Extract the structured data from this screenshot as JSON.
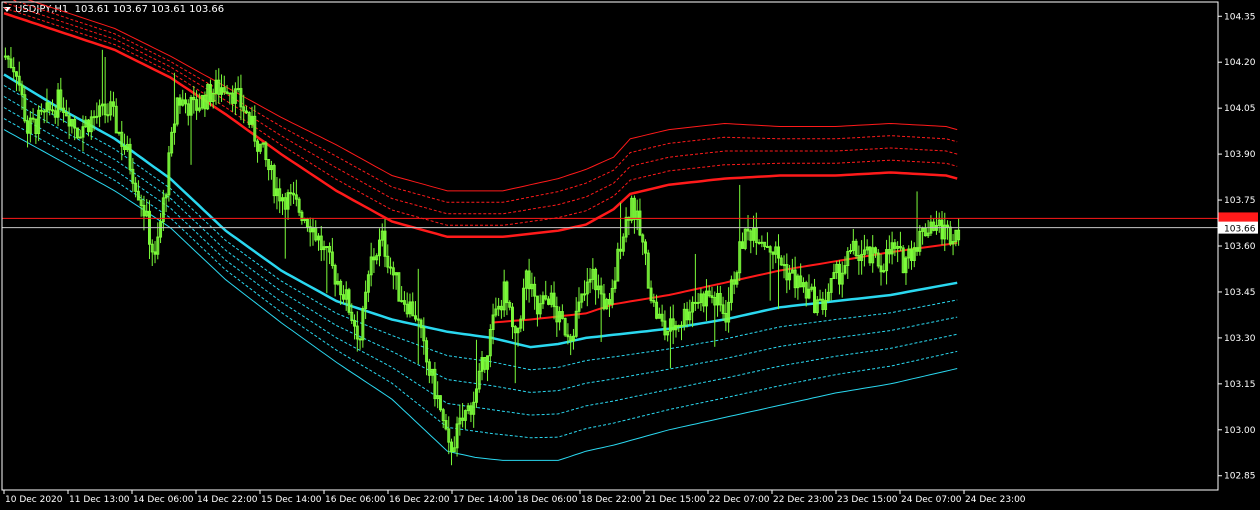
{
  "header": {
    "symbol": "USDJPY,H1",
    "ohlc": "103.61 103.67 103.61 103.66"
  },
  "colors": {
    "background": "#000000",
    "candle": "#7CFC3A",
    "upper_band": "#FF1A1A",
    "lower_band": "#2AD8F0",
    "bid_line": "#FF1A1A",
    "ask_line": "#C8C8C8",
    "axis": "#FFFFFF"
  },
  "price_tags": {
    "current": "103.66",
    "bid_level": 103.69
  },
  "chart_data": {
    "type": "candlestick",
    "title": "",
    "ylim": [
      102.81,
      104.39
    ],
    "y_ticks": [
      "104.35",
      "104.20",
      "104.05",
      "103.90",
      "103.75",
      "103.60",
      "103.45",
      "103.30",
      "103.15",
      "103.00",
      "102.85"
    ],
    "x_ticks": [
      "10 Dec 2020",
      "11 Dec 13:00",
      "14 Dec 06:00",
      "14 Dec 22:00",
      "15 Dec 14:00",
      "16 Dec 06:00",
      "16 Dec 22:00",
      "17 Dec 14:00",
      "18 Dec 06:00",
      "18 Dec 22:00",
      "21 Dec 15:00",
      "22 Dec 07:00",
      "22 Dec 23:00",
      "23 Dec 15:00",
      "24 Dec 07:00",
      "24 Dec 23:00"
    ],
    "close_path": [
      [
        0,
        104.22
      ],
      [
        4,
        104.18
      ],
      [
        8,
        103.98
      ],
      [
        14,
        104.02
      ],
      [
        20,
        104.08
      ],
      [
        26,
        103.98
      ],
      [
        32,
        104.02
      ],
      [
        38,
        104.04
      ],
      [
        44,
        103.9
      ],
      [
        50,
        103.72
      ],
      [
        54,
        103.55
      ],
      [
        58,
        103.8
      ],
      [
        62,
        104.08
      ],
      [
        68,
        104.05
      ],
      [
        74,
        104.1
      ],
      [
        80,
        104.13
      ],
      [
        86,
        104.05
      ],
      [
        92,
        103.92
      ],
      [
        98,
        103.78
      ],
      [
        104,
        103.74
      ],
      [
        110,
        103.68
      ],
      [
        116,
        103.56
      ],
      [
        122,
        103.45
      ],
      [
        128,
        103.3
      ],
      [
        132,
        103.55
      ],
      [
        136,
        103.62
      ],
      [
        142,
        103.45
      ],
      [
        148,
        103.38
      ],
      [
        152,
        103.22
      ],
      [
        156,
        103.1
      ],
      [
        160,
        102.93
      ],
      [
        166,
        103.05
      ],
      [
        170,
        103.12
      ],
      [
        176,
        103.35
      ],
      [
        180,
        103.45
      ],
      [
        184,
        103.28
      ],
      [
        188,
        103.5
      ],
      [
        192,
        103.38
      ],
      [
        196,
        103.44
      ],
      [
        200,
        103.35
      ],
      [
        204,
        103.32
      ],
      [
        208,
        103.42
      ],
      [
        212,
        103.5
      ],
      [
        218,
        103.38
      ],
      [
        222,
        103.62
      ],
      [
        226,
        103.75
      ],
      [
        230,
        103.6
      ],
      [
        234,
        103.4
      ],
      [
        238,
        103.32
      ],
      [
        244,
        103.36
      ],
      [
        248,
        103.42
      ],
      [
        254,
        103.44
      ],
      [
        260,
        103.38
      ],
      [
        266,
        103.62
      ],
      [
        270,
        103.66
      ],
      [
        276,
        103.6
      ],
      [
        282,
        103.52
      ],
      [
        288,
        103.46
      ],
      [
        294,
        103.4
      ],
      [
        300,
        103.5
      ],
      [
        306,
        103.58
      ],
      [
        312,
        103.56
      ],
      [
        316,
        103.54
      ],
      [
        320,
        103.59
      ],
      [
        324,
        103.55
      ],
      [
        330,
        103.63
      ],
      [
        334,
        103.68
      ],
      [
        340,
        103.64
      ],
      [
        344,
        103.66
      ]
    ],
    "upper_band_outer": [
      [
        0,
        104.43
      ],
      [
        40,
        104.31
      ],
      [
        60,
        104.22
      ],
      [
        80,
        104.12
      ],
      [
        100,
        104.02
      ],
      [
        120,
        103.93
      ],
      [
        140,
        103.83
      ],
      [
        160,
        103.78
      ],
      [
        180,
        103.78
      ],
      [
        200,
        103.82
      ],
      [
        210,
        103.85
      ],
      [
        220,
        103.89
      ],
      [
        226,
        103.95
      ],
      [
        240,
        103.98
      ],
      [
        260,
        104.0
      ],
      [
        280,
        103.99
      ],
      [
        300,
        103.99
      ],
      [
        320,
        104.0
      ],
      [
        340,
        103.99
      ],
      [
        344,
        103.98
      ]
    ],
    "upper_band_main": [
      [
        0,
        104.36
      ],
      [
        40,
        104.24
      ],
      [
        60,
        104.15
      ],
      [
        80,
        104.03
      ],
      [
        100,
        103.9
      ],
      [
        120,
        103.78
      ],
      [
        140,
        103.68
      ],
      [
        160,
        103.63
      ],
      [
        180,
        103.63
      ],
      [
        200,
        103.65
      ],
      [
        210,
        103.67
      ],
      [
        220,
        103.72
      ],
      [
        226,
        103.77
      ],
      [
        240,
        103.8
      ],
      [
        260,
        103.82
      ],
      [
        280,
        103.83
      ],
      [
        300,
        103.83
      ],
      [
        320,
        103.84
      ],
      [
        340,
        103.83
      ],
      [
        344,
        103.82
      ]
    ],
    "middle_line": [
      [
        176,
        103.35
      ],
      [
        190,
        103.36
      ],
      [
        200,
        103.37
      ],
      [
        210,
        103.38
      ],
      [
        220,
        103.41
      ],
      [
        240,
        103.44
      ],
      [
        260,
        103.48
      ],
      [
        280,
        103.52
      ],
      [
        300,
        103.55
      ],
      [
        320,
        103.58
      ],
      [
        344,
        103.61
      ]
    ],
    "lower_band_main": [
      [
        0,
        104.16
      ],
      [
        20,
        104.05
      ],
      [
        40,
        103.95
      ],
      [
        60,
        103.82
      ],
      [
        80,
        103.65
      ],
      [
        100,
        103.52
      ],
      [
        120,
        103.42
      ],
      [
        140,
        103.36
      ],
      [
        160,
        103.32
      ],
      [
        176,
        103.3
      ],
      [
        190,
        103.27
      ],
      [
        200,
        103.28
      ],
      [
        210,
        103.3
      ],
      [
        220,
        103.31
      ],
      [
        240,
        103.33
      ],
      [
        260,
        103.36
      ],
      [
        280,
        103.4
      ],
      [
        300,
        103.42
      ],
      [
        320,
        103.44
      ],
      [
        344,
        103.48
      ]
    ],
    "lower_band_outer": [
      [
        0,
        103.98
      ],
      [
        20,
        103.88
      ],
      [
        40,
        103.78
      ],
      [
        60,
        103.66
      ],
      [
        80,
        103.49
      ],
      [
        100,
        103.35
      ],
      [
        120,
        103.22
      ],
      [
        140,
        103.1
      ],
      [
        160,
        102.93
      ],
      [
        170,
        102.91
      ],
      [
        180,
        102.9
      ],
      [
        200,
        102.9
      ],
      [
        210,
        102.93
      ],
      [
        220,
        102.95
      ],
      [
        240,
        103.0
      ],
      [
        260,
        103.04
      ],
      [
        280,
        103.08
      ],
      [
        300,
        103.12
      ],
      [
        320,
        103.15
      ],
      [
        344,
        103.2
      ]
    ]
  }
}
